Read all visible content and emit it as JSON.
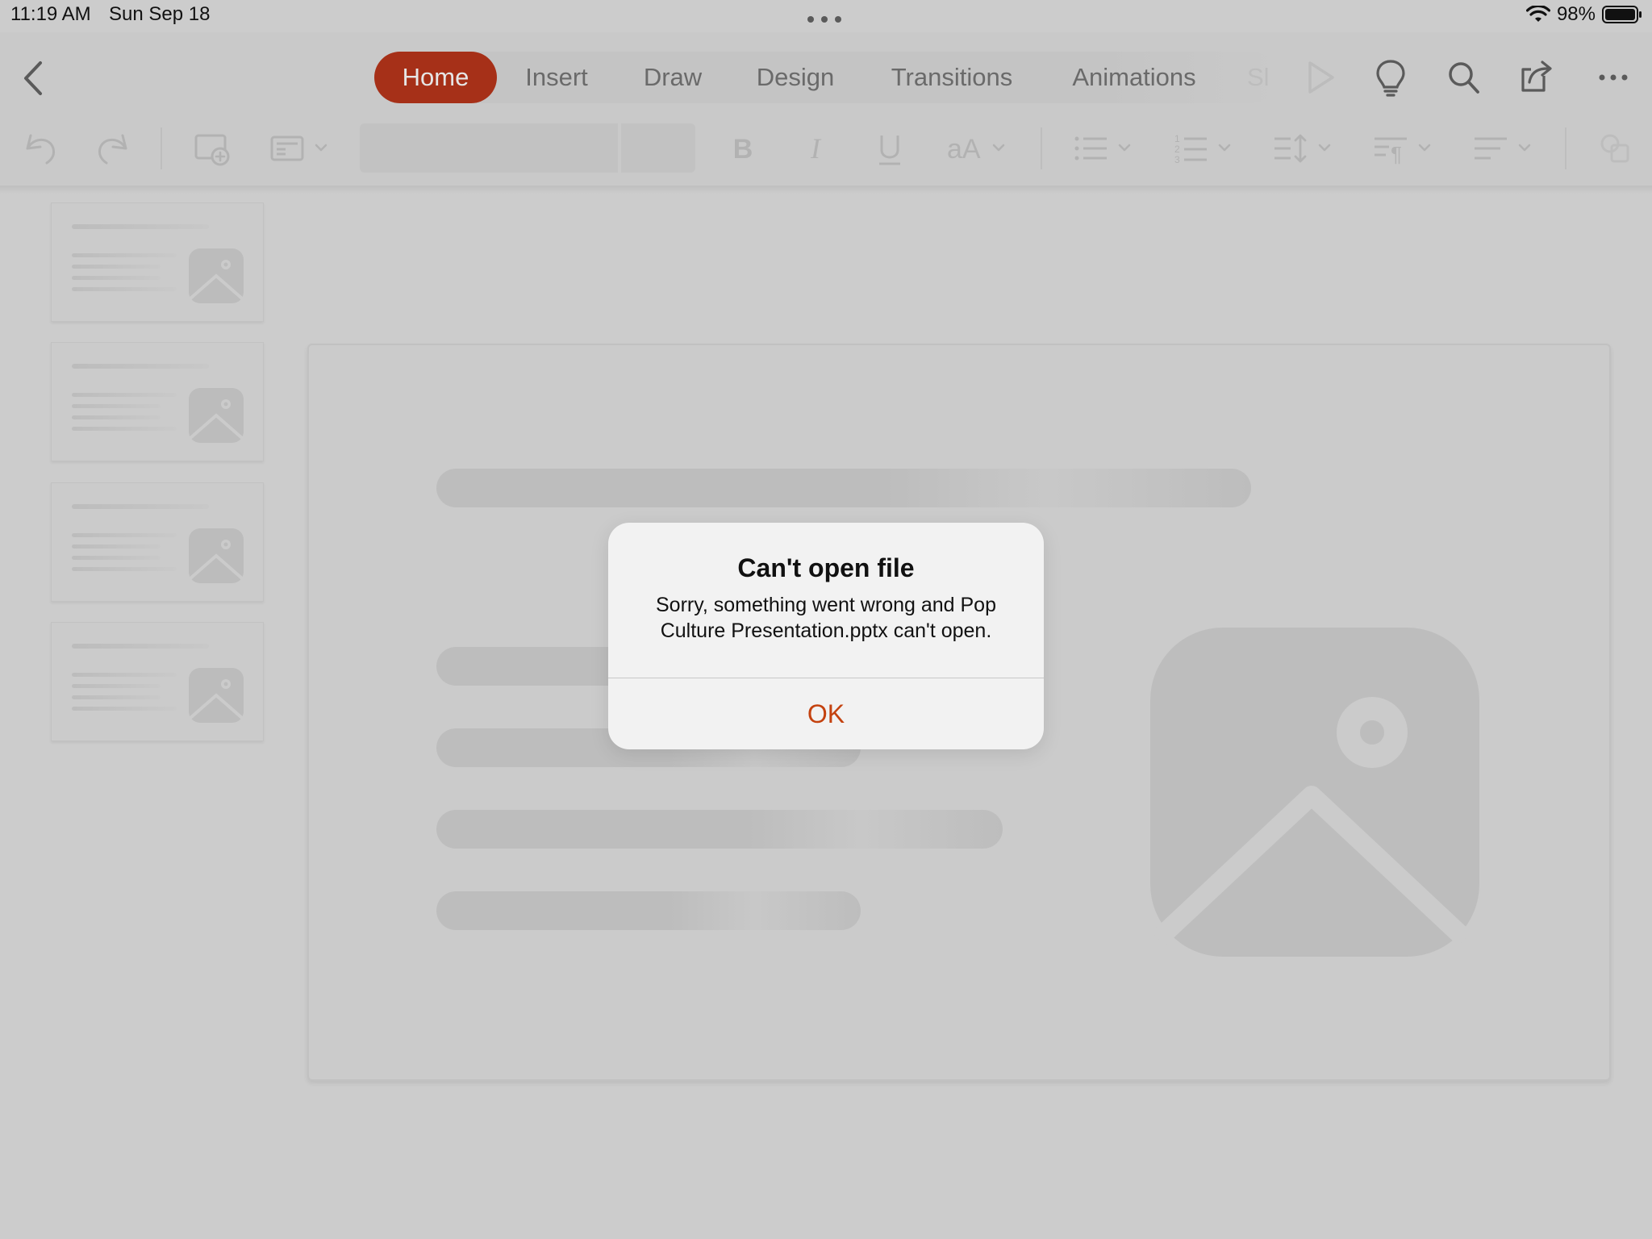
{
  "status_bar": {
    "time": "11:19 AM",
    "date": "Sun Sep 18",
    "battery": "98%",
    "icons": [
      "wifi-icon",
      "battery-icon"
    ]
  },
  "ribbon": {
    "tabs": [
      {
        "label": "Home",
        "active": true
      },
      {
        "label": "Insert",
        "active": false
      },
      {
        "label": "Draw",
        "active": false
      },
      {
        "label": "Design",
        "active": false
      },
      {
        "label": "Transitions",
        "active": false
      },
      {
        "label": "Animations",
        "active": false
      },
      {
        "label": "Sl",
        "active": false
      }
    ],
    "top_icons": [
      "back-icon",
      "play-icon",
      "lightbulb-icon",
      "search-icon",
      "share-icon",
      "more-icon"
    ],
    "tool_icons": [
      "undo-icon",
      "redo-icon",
      "new-slide-icon",
      "layout-icon",
      "bold-icon",
      "italic-icon",
      "underline-icon",
      "font-size-icon",
      "bullets-icon",
      "numbering-icon",
      "line-spacing-icon",
      "paragraph-icon",
      "align-icon"
    ]
  },
  "dialog": {
    "title": "Can't open file",
    "message": "Sorry, something went wrong and Pop Culture Presentation.pptx can't open.",
    "ok_label": "OK"
  },
  "colors": {
    "accent": "#a63018",
    "ok_text": "#c4420f",
    "background": "#cccccc"
  }
}
